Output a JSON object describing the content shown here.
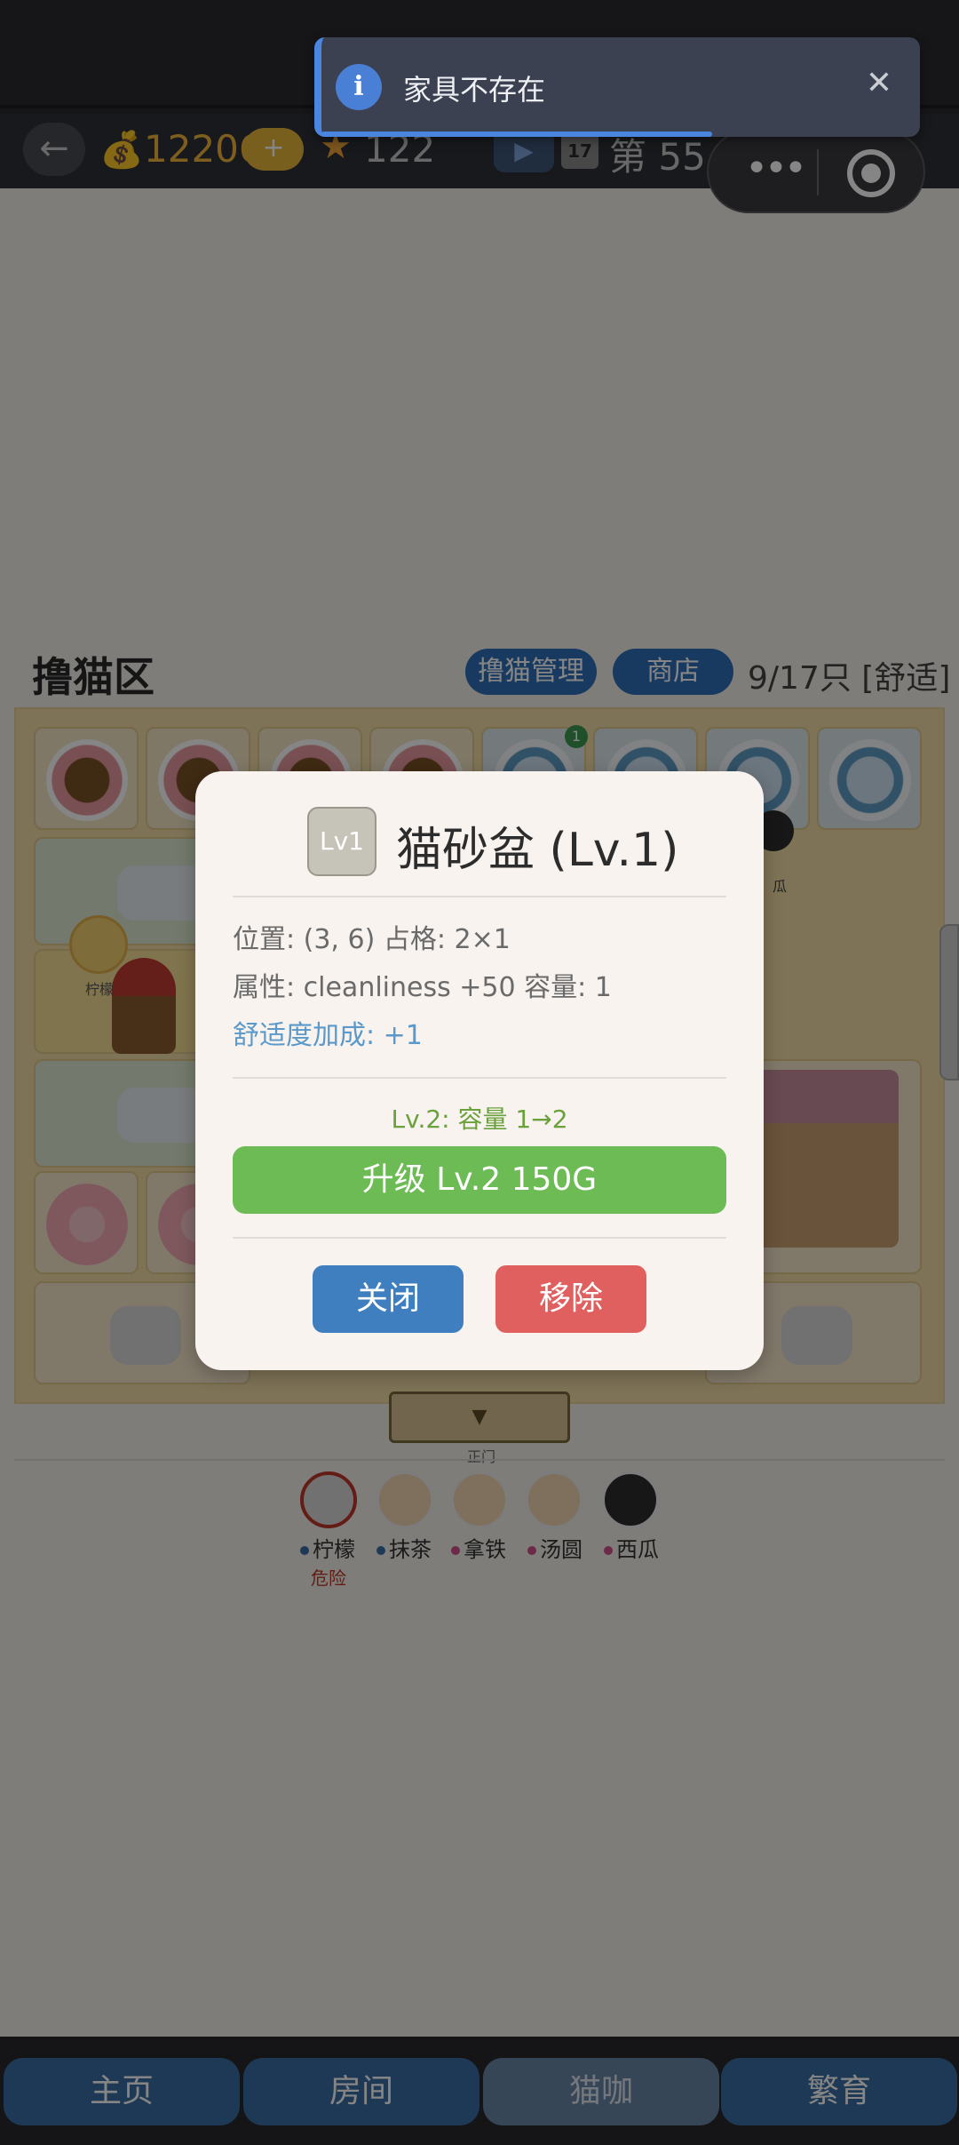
{
  "toast": {
    "message": "家具不存在",
    "icon": "info-icon",
    "close_glyph": "✕"
  },
  "hud": {
    "back_glyph": "←",
    "coins": "12206",
    "plus_label": "+",
    "stars": "122",
    "calendar_day": "17",
    "day_label": "第 55 天"
  },
  "capsule": {
    "more_glyph": "•••"
  },
  "area": {
    "title": "撸猫区",
    "manage_label": "撸猫管理",
    "shop_label": "商店",
    "capacity": "9/17只 [舒适]"
  },
  "grid": {
    "notification_count": "1",
    "cat_label": "柠檬",
    "partial_label": "瓜",
    "gate_arrow": "▼",
    "gate_label": "正门"
  },
  "cats": [
    {
      "name": "柠檬",
      "dot_color": "#3a6ea3"
    },
    {
      "name": "抹茶",
      "dot_color": "#3a6ea3"
    },
    {
      "name": "拿铁",
      "dot_color": "#d0508a"
    },
    {
      "name": "汤圆",
      "dot_color": "#d0508a"
    },
    {
      "name": "西瓜",
      "dot_color": "#d0508a"
    }
  ],
  "danger_label": "危险",
  "modal": {
    "level_badge": "Lv1",
    "title": "猫砂盆 (Lv.1)",
    "position_line": "位置: (3, 6)  占格: 2×1",
    "attribute_line": "属性: cleanliness +50  容量: 1",
    "comfort_line": "舒适度加成: +1",
    "upgrade_hint": "Lv.2: 容量 1→2",
    "upgrade_button": "升级 Lv.2  150G",
    "close_button": "关闭",
    "remove_button": "移除"
  },
  "tabs": [
    "主页",
    "房间",
    "猫咖",
    "繁育"
  ],
  "active_tab": "猫咖",
  "colors": {
    "primary_blue": "#3f7fbf",
    "upgrade_green": "#6dbb55",
    "remove_red": "#e0605f",
    "coin_gold": "#f0b43a"
  }
}
